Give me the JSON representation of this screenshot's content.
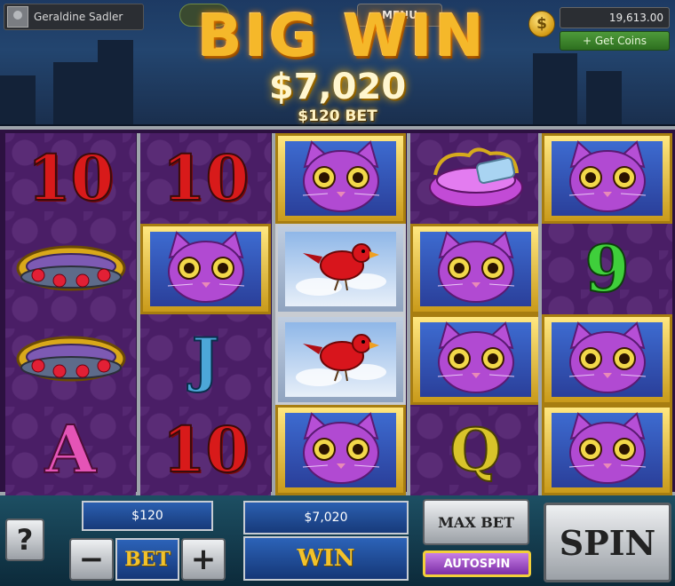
{
  "header": {
    "player_name": "Geraldine Sadler",
    "menu_label": "MENU",
    "coin_balance": "19,613.00",
    "get_coins_label": "+ Get Coins",
    "coin_icon": "coin-icon"
  },
  "win_banner": {
    "title": "BIG WIN",
    "amount": "$7,020",
    "bet_caption": "$120 BET"
  },
  "reels": [
    [
      {
        "type": "text",
        "value": "10",
        "style": "ten"
      },
      {
        "type": "icon",
        "value": "jeweled-collar-icon"
      },
      {
        "type": "icon",
        "value": "jeweled-collar-icon"
      },
      {
        "type": "text",
        "value": "A",
        "style": "ace"
      }
    ],
    [
      {
        "type": "text",
        "value": "10",
        "style": "ten"
      },
      {
        "type": "icon",
        "value": "cat-icon"
      },
      {
        "type": "text",
        "value": "J",
        "style": "jack"
      },
      {
        "type": "text",
        "value": "10",
        "style": "ten"
      }
    ],
    [
      {
        "type": "icon",
        "value": "cat-icon"
      },
      {
        "type": "icon",
        "value": "bird-icon"
      },
      {
        "type": "icon",
        "value": "bird-icon"
      },
      {
        "type": "icon",
        "value": "cat-icon"
      }
    ],
    [
      {
        "type": "icon",
        "value": "pet-bed-icon"
      },
      {
        "type": "icon",
        "value": "cat-icon"
      },
      {
        "type": "icon",
        "value": "cat-icon"
      },
      {
        "type": "text",
        "value": "Q",
        "style": "queen"
      }
    ],
    [
      {
        "type": "icon",
        "value": "cat-icon"
      },
      {
        "type": "text",
        "value": "9",
        "style": "nine"
      },
      {
        "type": "icon",
        "value": "cat-icon"
      },
      {
        "type": "icon",
        "value": "cat-icon"
      }
    ]
  ],
  "controls": {
    "help_label": "?",
    "bet_value": "$120",
    "bet_label": "BET",
    "minus_label": "−",
    "plus_label": "+",
    "win_value": "$7,020",
    "win_label": "WIN",
    "max_bet_label": "MAX BET",
    "autospin_label": "AUTOSPIN",
    "spin_label": "SPIN"
  },
  "colors": {
    "banner_gold": "#f5b82a",
    "reel_purple": "#4a1e66",
    "frame_gold": "#c99a1a",
    "autospin_purple": "#9a45c4"
  }
}
